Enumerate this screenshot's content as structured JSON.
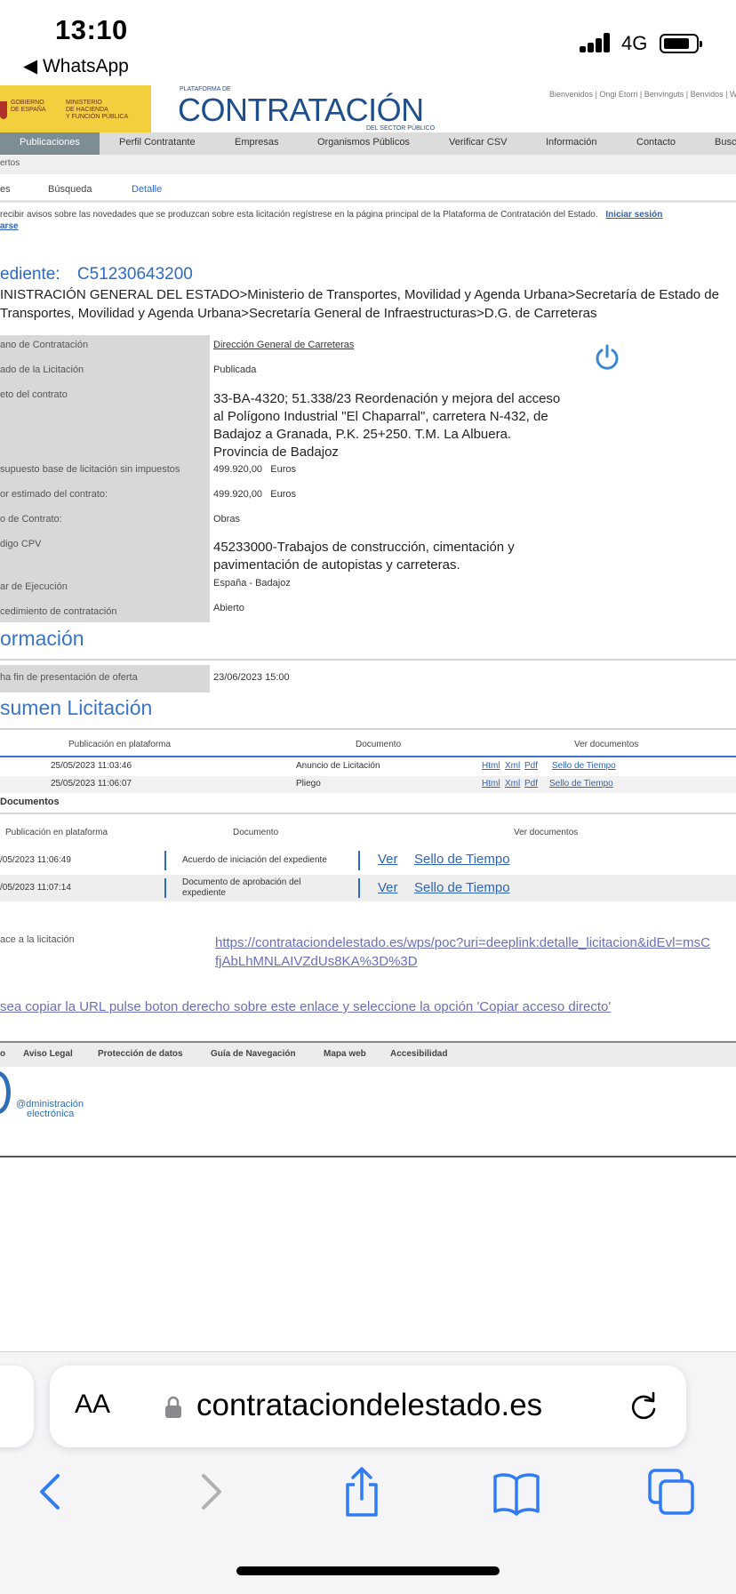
{
  "status_bar": {
    "time": "13:10",
    "back_app": "◀ WhatsApp",
    "network": "4G"
  },
  "header": {
    "gobierno": "GOBIERNO\nDE ESPAÑA",
    "ministerio": "MINISTERIO\nDE HACIENDA\nY FUNCIÓN PÚBLICA",
    "logo_pre": "PLATAFORMA DE",
    "logo": "CONTRATACIÓN",
    "logo_sub": "DEL SECTOR PÚBLICO",
    "welcome": "Bienvenidos | Ongi Etorri | Benvinguts | Benvidos | Welcome"
  },
  "nav": {
    "items": [
      "Publicaciones",
      "Perfil Contratante",
      "Empresas",
      "Organismos Públicos",
      "Verificar CSV",
      "Información",
      "Contacto",
      "Buscar"
    ]
  },
  "subnav": {
    "label": "ertos"
  },
  "tabs": {
    "items": [
      "es",
      "Búsqueda",
      "Detalle"
    ]
  },
  "notice": {
    "text": "recibir avisos sobre las novedades que se produzcan sobre esta licitación regístrese en la página principal de la Plataforma de Contratación del Estado.",
    "link1": "Iniciar sesión",
    "link2": "arse"
  },
  "expediente": {
    "label": "ediente:",
    "number": "C51230643200",
    "path": "INISTRACIÓN GENERAL DEL ESTADO>Ministerio de Transportes, Movilidad y Agenda Urbana>Secretaría de Estado de Transportes, Movilidad y Agenda Urbana>Secretaría General de Infraestructuras>D.G. de Carreteras"
  },
  "details": {
    "organo_label": "ano de Contratación",
    "organo_value": "Dirección General de Carreteras",
    "estado_label": "ado de la Licitación",
    "estado_value": "Publicada",
    "objeto_label": "eto del contrato",
    "objeto_value": "33-BA-4320; 51.338/23 Reordenación y mejora del acceso al Polígono Industrial \"El Chaparral\", carretera N-432, de Badajoz a Granada, P.K. 25+250. T.M. La Albuera. Provincia de Badajoz",
    "presupuesto_label": "supuesto base de licitación sin impuestos",
    "presupuesto_value": "499.920,00",
    "presupuesto_unit": "Euros",
    "valor_label": "or estimado del contrato:",
    "valor_value": "499.920,00",
    "valor_unit": "Euros",
    "tipo_label": "o de Contrato:",
    "tipo_value": "Obras",
    "cpv_label": "digo CPV",
    "cpv_value": "45233000-Trabajos de construcción, cimentación y pavimentación de autopistas y carreteras.",
    "lugar_label": "ar de Ejecución",
    "lugar_value": "España - Badajoz",
    "proc_label": "cedimiento de contratación",
    "proc_value": "Abierto"
  },
  "informacion": {
    "title": "ormación",
    "fecha_label": "ha fin de presentación de oferta",
    "fecha_value": "23/06/2023 15:00"
  },
  "resumen": {
    "title": "sumen Licitación",
    "headers": [
      "Publicación en plataforma",
      "Documento",
      "Ver documentos"
    ],
    "rows": [
      {
        "date": "25/05/2023 11:03:46",
        "doc": "Anuncio de Licitación"
      },
      {
        "date": "25/05/2023 11:06:07",
        "doc": "Pliego"
      }
    ],
    "link_html": "Html",
    "link_xml": "Xml",
    "link_pdf": "Pdf",
    "link_sello": "Sello de Tiempo"
  },
  "otros": {
    "title": "Documentos",
    "headers": [
      "Publicación en plataforma",
      "Documento",
      "Ver documentos"
    ],
    "rows": [
      {
        "date": "/05/2023 11:06:49",
        "doc": "Acuerdo de iniciación del expediente"
      },
      {
        "date": "/05/2023 11:07:14",
        "doc": "Documento de aprobación del expediente"
      }
    ],
    "ver": "Ver",
    "sello": "Sello de Tiempo"
  },
  "enlace": {
    "label": "ace a la licitación",
    "url": "https://contrataciondelestado.es/wps/poc?uri=deeplink:detalle_licitacion&idEvl=msCfjAbLhMNLAIVZdUs8KA%3D%3D",
    "copy_hint": "sea copiar la URL pulse boton derecho sobre este enlace y seleccione la opción 'Copiar acceso directo'"
  },
  "footer": {
    "items": [
      "o",
      "Aviso Legal",
      "Protección de datos",
      "Guía de Navegación",
      "Mapa web",
      "Accesibilidad"
    ],
    "adm_line1": "@dministración",
    "adm_line2": "electrónica"
  },
  "safari": {
    "aa": "AA",
    "domain": "contrataciondelestado.es"
  },
  "icons": {
    "power": "power-icon",
    "lock": "lock-icon",
    "reload": "reload-icon",
    "back": "back-icon",
    "forward": "forward-icon",
    "share": "share-icon",
    "bookmarks": "bookmarks-icon",
    "tabs": "tabs-icon"
  },
  "colors": {
    "accent": "#2e6bbf",
    "gov_yellow": "#f2cf3c",
    "nav_active": "#7d8d94"
  }
}
